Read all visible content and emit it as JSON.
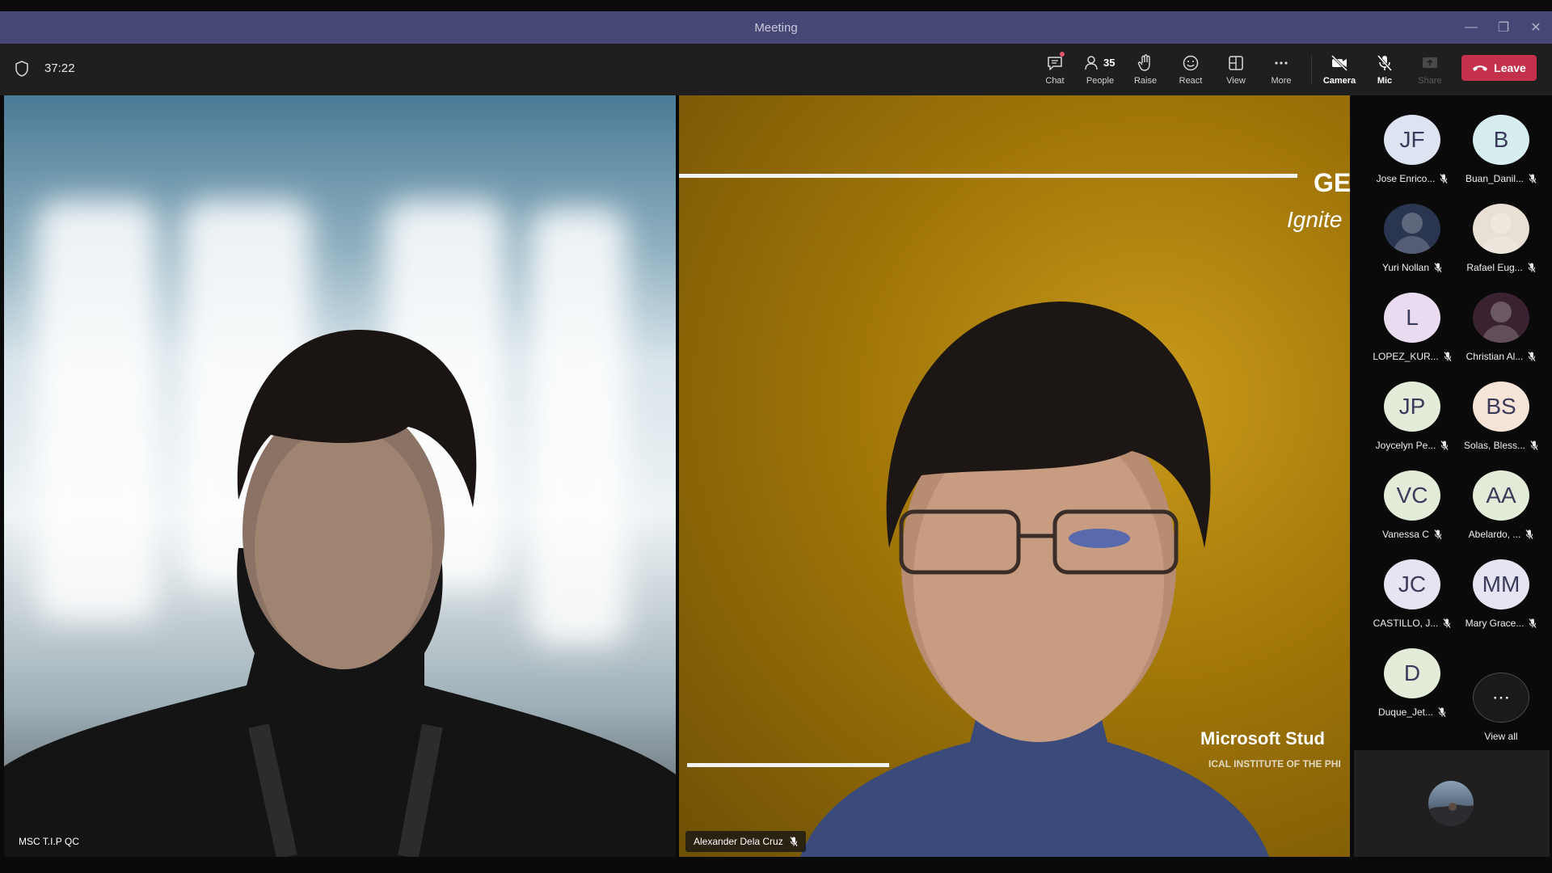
{
  "window": {
    "title": "Meeting"
  },
  "toolbar": {
    "timer": "37:22",
    "chat_label": "Chat",
    "people_label": "People",
    "people_count": "35",
    "raise_label": "Raise",
    "react_label": "React",
    "view_label": "View",
    "more_label": "More",
    "camera_label": "Camera",
    "mic_label": "Mic",
    "share_label": "Share",
    "leave_label": "Leave"
  },
  "stage": {
    "left_tile_name": "MSC T.I.P QC",
    "right_tile_name": "Alexander Dela Cruz",
    "slide_text_top": "GE",
    "slide_text_sub": "Ignite",
    "slide_text_org": "Microsoft Stud",
    "slide_text_inst": "ICAL INSTITUTE OF THE PHI"
  },
  "roster": {
    "participants": [
      {
        "initials": "JF",
        "name": "Jose Enrico...",
        "bg": "#dde3f0"
      },
      {
        "initials": "B",
        "name": "Buan_Danil...",
        "bg": "#d6eef0"
      },
      {
        "initials": "",
        "name": "Yuri Nollan",
        "bg": "#2a3550"
      },
      {
        "initials": "",
        "name": "Rafael Eug...",
        "bg": "#e8e0d4"
      },
      {
        "initials": "L",
        "name": "LOPEZ_KUR...",
        "bg": "#eadcf0"
      },
      {
        "initials": "",
        "name": "Christian Al...",
        "bg": "#3a2230"
      },
      {
        "initials": "JP",
        "name": "Joycelyn Pe...",
        "bg": "#e3ecd8"
      },
      {
        "initials": "BS",
        "name": "Solas, Bless...",
        "bg": "#f6e4d8"
      },
      {
        "initials": "VC",
        "name": "Vanessa C",
        "bg": "#e3ecd8"
      },
      {
        "initials": "AA",
        "name": "Abelardo, ...",
        "bg": "#e3ecd8"
      },
      {
        "initials": "JC",
        "name": "CASTILLO, J...",
        "bg": "#e6e4f2"
      },
      {
        "initials": "MM",
        "name": "Mary Grace...",
        "bg": "#e6e4f2"
      },
      {
        "initials": "D",
        "name": "Duque_Jet...",
        "bg": "#e3ecd8"
      }
    ],
    "view_all_label": "View all"
  },
  "colors": {
    "titlebar": "#464775",
    "leave": "#c4314b",
    "toolbar": "#1f1f1f"
  }
}
